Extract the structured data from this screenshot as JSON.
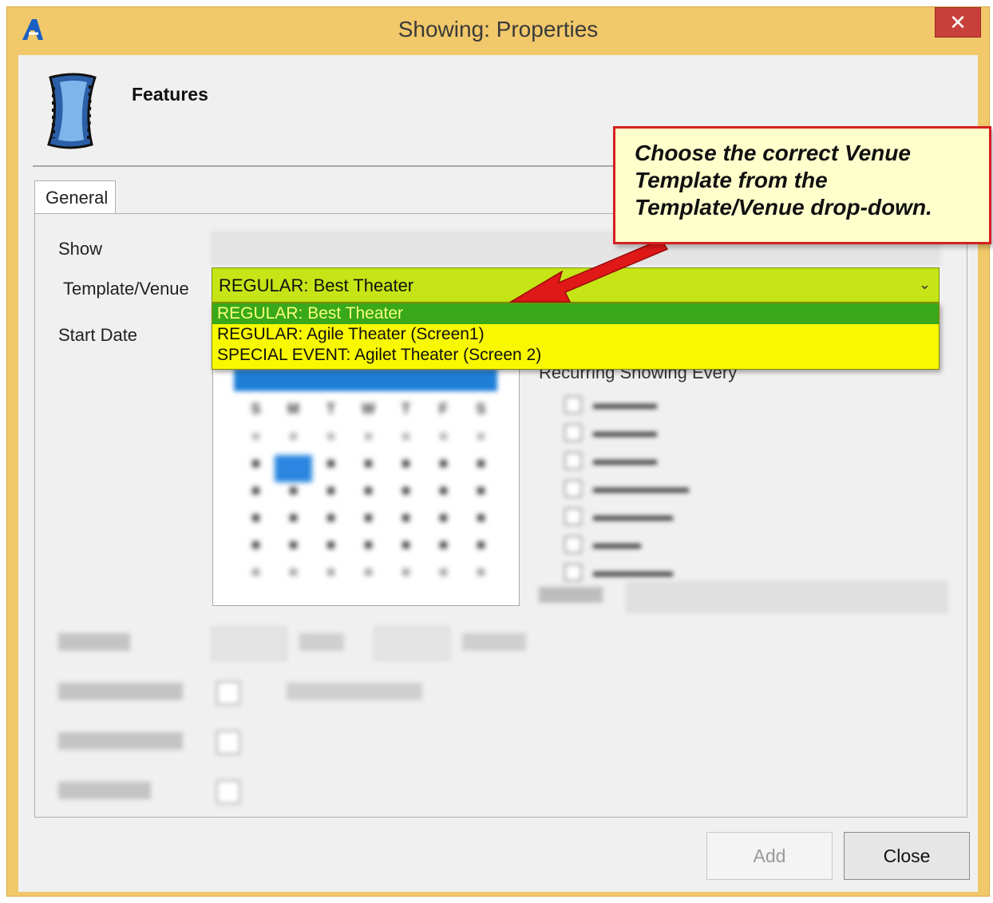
{
  "window": {
    "title": "Showing: Properties",
    "close_glyph": "✕"
  },
  "header": {
    "title": "Features"
  },
  "tabs": [
    {
      "label": "General"
    }
  ],
  "form": {
    "show_label": "Show",
    "template_venue_label": "Template/Venue",
    "start_date_label": "Start Date",
    "template_venue_selected": "REGULAR: Best Theater",
    "template_venue_options": [
      "REGULAR: Best Theater",
      "REGULAR: Agile Theater (Screen1)",
      "SPECIAL EVENT: Agilet Theater (Screen 2)"
    ],
    "recurring_label": "Recurring Showing Every"
  },
  "footer": {
    "add_label": "Add",
    "close_label": "Close"
  },
  "callout": {
    "line1": "Choose the correct Venue",
    "line2": "Template from the",
    "line3": "Template/Venue drop-down."
  },
  "colors": {
    "combo_bg": "#c6e516",
    "dropdown_bg": "#f8f800",
    "selected_bg": "#39a81a",
    "callout_border": "#d42020",
    "arrow": "#e01818"
  }
}
